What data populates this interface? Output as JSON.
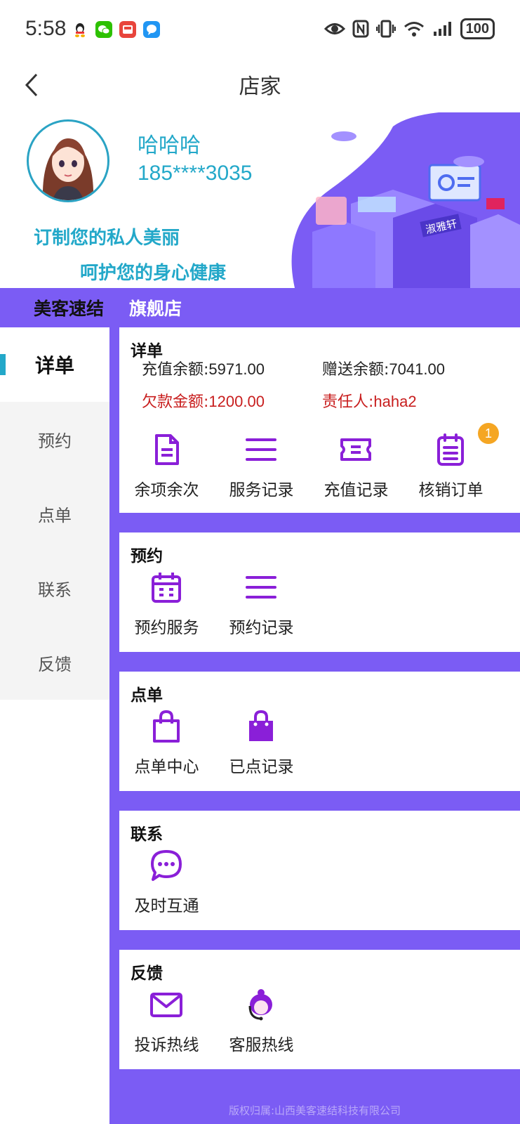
{
  "status_bar": {
    "time": "5:58",
    "battery": "100",
    "notification_icons": [
      "qq-icon",
      "wechat-icon",
      "mail-icon",
      "message-icon"
    ],
    "system_icons": [
      "eye-icon",
      "nfc-icon",
      "vibrate-icon",
      "wifi-icon",
      "signal-icon",
      "battery-icon"
    ]
  },
  "navbar": {
    "title": "店家"
  },
  "profile": {
    "name": "哈哈哈",
    "phone": "185****3035",
    "slogan_line1": "订制您的私人美丽",
    "slogan_line2": "呵护您的身心健康",
    "store_name": "美客速结",
    "store_type": "旗舰店",
    "banner_sign": "淑雅轩"
  },
  "menu": {
    "items": [
      {
        "label": "详单",
        "active": true
      },
      {
        "label": "预约",
        "active": false
      },
      {
        "label": "点单",
        "active": false
      },
      {
        "label": "联系",
        "active": false
      },
      {
        "label": "反馈",
        "active": false
      }
    ]
  },
  "detail": {
    "title": "详单",
    "recharge_label": "充值余额:",
    "recharge_value": "5971.00",
    "gift_label": "赠送余额:",
    "gift_value": "7041.00",
    "debt_label": "欠款金额:",
    "debt_value": "1200.00",
    "owner_label": "责任人:",
    "owner_value": "haha2",
    "actions": [
      {
        "label": "余项余次",
        "icon": "document-icon"
      },
      {
        "label": "服务记录",
        "icon": "list-icon"
      },
      {
        "label": "充值记录",
        "icon": "ticket-icon"
      },
      {
        "label": "核销订单",
        "icon": "clipboard-icon",
        "badge": "1"
      }
    ]
  },
  "booking": {
    "title": "预约",
    "actions": [
      {
        "label": "预约服务",
        "icon": "calendar-icon"
      },
      {
        "label": "预约记录",
        "icon": "list-icon"
      }
    ]
  },
  "order": {
    "title": "点单",
    "actions": [
      {
        "label": "点单中心",
        "icon": "shopping-bag-outline-icon"
      },
      {
        "label": "已点记录",
        "icon": "shopping-bag-filled-icon"
      }
    ]
  },
  "contact": {
    "title": "联系",
    "actions": [
      {
        "label": "及时互通",
        "icon": "chat-bubble-icon"
      }
    ]
  },
  "feedback": {
    "title": "反馈",
    "actions": [
      {
        "label": "投诉热线",
        "icon": "envelope-icon"
      },
      {
        "label": "客服热线",
        "icon": "headset-agent-icon"
      }
    ]
  },
  "footer": {
    "copyright": "版权归属:山西美客速结科技有限公司"
  },
  "colors": {
    "accent_purple": "#7b5cf4",
    "icon_purple": "#8a1fd8",
    "teal": "#23a8c9",
    "warning_red": "#c81e1e",
    "badge_orange": "#f5a623"
  }
}
